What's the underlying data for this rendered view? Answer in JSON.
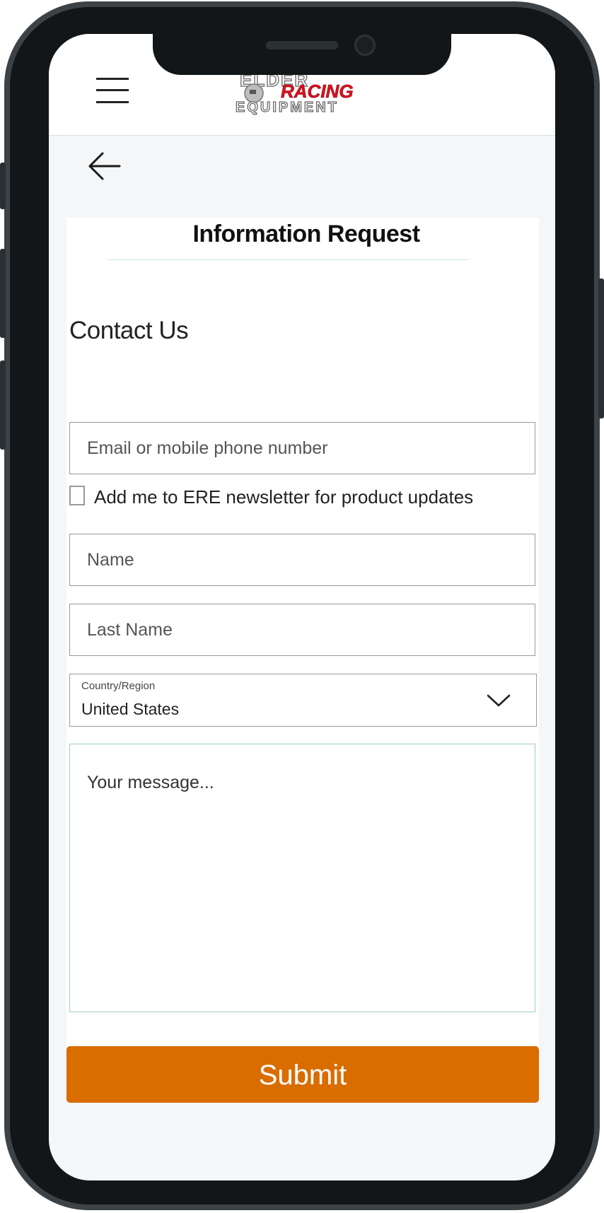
{
  "header": {
    "menu_icon": "hamburger-menu-icon",
    "logo": {
      "line1": "ELDER",
      "line2": "RACING",
      "line3": "EQUIPMENT"
    }
  },
  "nav": {
    "back_icon": "arrow-left-icon"
  },
  "page": {
    "title": "Information Request",
    "section_title": "Contact Us"
  },
  "form": {
    "email_placeholder": "Email or mobile phone number",
    "newsletter_label": "Add me to ERE newsletter for product updates",
    "newsletter_checked": false,
    "name_placeholder": "Name",
    "last_name_placeholder": "Last Name",
    "country_label": "Country/Region",
    "country_value": "United States",
    "message_placeholder": "Your message...",
    "submit_label": "Submit"
  },
  "colors": {
    "accent": "#d96d00",
    "logo_red": "#e0101e",
    "page_bg": "#f5f6f8",
    "device_frame": "#121618"
  }
}
